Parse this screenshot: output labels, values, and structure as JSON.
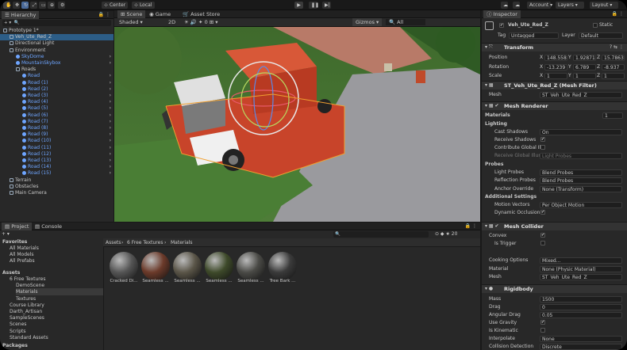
{
  "toolbar": {
    "pivot": "Center",
    "space": "Local",
    "account": "Account",
    "layers": "Layers",
    "layout": "Layout"
  },
  "hierarchy": {
    "tab": "Hierarchy",
    "items": [
      {
        "label": "Prototype 1*",
        "indent": 0,
        "kind": "scene"
      },
      {
        "label": "Veh_Ute_Red_Z",
        "indent": 1,
        "kind": "obj"
      },
      {
        "label": "Directional Light",
        "indent": 1,
        "kind": "obj"
      },
      {
        "label": "Environment",
        "indent": 1,
        "kind": "obj"
      },
      {
        "label": "SkyDome",
        "indent": 2,
        "kind": "prefab"
      },
      {
        "label": "MountainSkybox",
        "indent": 2,
        "kind": "prefab"
      },
      {
        "label": "Roads",
        "indent": 2,
        "kind": "obj"
      },
      {
        "label": "Road",
        "indent": 3,
        "kind": "prefab"
      },
      {
        "label": "Road (1)",
        "indent": 3,
        "kind": "prefab"
      },
      {
        "label": "Road (2)",
        "indent": 3,
        "kind": "prefab"
      },
      {
        "label": "Road (3)",
        "indent": 3,
        "kind": "prefab"
      },
      {
        "label": "Road (4)",
        "indent": 3,
        "kind": "prefab"
      },
      {
        "label": "Road (5)",
        "indent": 3,
        "kind": "prefab"
      },
      {
        "label": "Road (6)",
        "indent": 3,
        "kind": "prefab"
      },
      {
        "label": "Road (7)",
        "indent": 3,
        "kind": "prefab"
      },
      {
        "label": "Road (8)",
        "indent": 3,
        "kind": "prefab"
      },
      {
        "label": "Road (9)",
        "indent": 3,
        "kind": "prefab"
      },
      {
        "label": "Road (10)",
        "indent": 3,
        "kind": "prefab"
      },
      {
        "label": "Road (11)",
        "indent": 3,
        "kind": "prefab"
      },
      {
        "label": "Road (12)",
        "indent": 3,
        "kind": "prefab"
      },
      {
        "label": "Road (13)",
        "indent": 3,
        "kind": "prefab"
      },
      {
        "label": "Road (14)",
        "indent": 3,
        "kind": "prefab"
      },
      {
        "label": "Road (15)",
        "indent": 3,
        "kind": "prefab"
      },
      {
        "label": "Terrain",
        "indent": 1,
        "kind": "obj"
      },
      {
        "label": "Obstacles",
        "indent": 1,
        "kind": "obj"
      },
      {
        "label": "Main Camera",
        "indent": 1,
        "kind": "obj"
      }
    ]
  },
  "scene": {
    "tabs": [
      "Scene",
      "Game",
      "Asset Store"
    ],
    "shading": "Shaded",
    "mode2d": "2D",
    "gizmos": "Gizmos",
    "gizmo_count": "0"
  },
  "inspector": {
    "tab": "Inspector",
    "name": "Veh_Ute_Red_Z",
    "static": "Static",
    "tag_label": "Tag",
    "tag": "Untagged",
    "layer_label": "Layer",
    "layer": "Default",
    "transform": {
      "title": "Transform",
      "position_label": "Position",
      "rotation_label": "Rotation",
      "scale_label": "Scale",
      "position": {
        "x": "148.558",
        "y": "1.92871",
        "z": "15.7863"
      },
      "rotation": {
        "x": "-13.239",
        "y": "6.789",
        "z": "-8.937"
      },
      "scale": {
        "x": "1",
        "y": "1",
        "z": "1"
      }
    },
    "meshfilter": {
      "title": "ST_Veh_Ute_Red_Z (Mesh Filter)",
      "mesh_label": "Mesh",
      "mesh": "ST_Veh_Ute_Red_Z"
    },
    "renderer": {
      "title": "Mesh Renderer",
      "materials": "Materials",
      "materials_count": "1",
      "lighting": "Lighting",
      "cast_label": "Cast Shadows",
      "cast": "On",
      "receive_label": "Receive Shadows",
      "contribute_label": "Contribute Global Il",
      "receive_gi_label": "Receive Global Illum",
      "receive_gi": "Light Probes",
      "probes": "Probes",
      "lightprobes_label": "Light Probes",
      "lightprobes": "Blend Probes",
      "reflection_label": "Reflection Probes",
      "reflection": "Blend Probes",
      "anchor_label": "Anchor Override",
      "anchor": "None (Transform)",
      "additional": "Additional Settings",
      "motion_label": "Motion Vectors",
      "motion": "Per Object Motion",
      "occlusion_label": "Dynamic Occlusion"
    },
    "collider": {
      "title": "Mesh Collider",
      "convex_label": "Convex",
      "trigger_label": "Is Trigger",
      "cooking_label": "Cooking Options",
      "cooking": "Mixed...",
      "material_label": "Material",
      "material": "None (Physic Material)",
      "mesh_label": "Mesh",
      "mesh": "ST_Veh_Ute_Red_Z"
    },
    "rigidbody": {
      "title": "Rigidbody",
      "mass_label": "Mass",
      "mass": "1500",
      "drag_label": "Drag",
      "drag": "0",
      "angular_label": "Angular Drag",
      "angular": "0.05",
      "gravity_label": "Use Gravity",
      "kinematic_label": "Is Kinematic",
      "interpolate_label": "Interpolate",
      "interpolate": "None",
      "collision_label": "Collision Detection",
      "collision": "Discrete"
    }
  },
  "project": {
    "tabs": [
      "Project",
      "Console"
    ],
    "breadcrumb": [
      "Assets",
      "6 Free Textures",
      "Materials"
    ],
    "favorites": "Favorites",
    "fav_items": [
      "All Materials",
      "All Models",
      "All Prefabs"
    ],
    "assets": "Assets",
    "tree": [
      {
        "label": "6 Free Textures",
        "indent": 1
      },
      {
        "label": "DemoScene",
        "indent": 2
      },
      {
        "label": "Materials",
        "indent": 2
      },
      {
        "label": "Textures",
        "indent": 2
      },
      {
        "label": "Course Library",
        "indent": 1
      },
      {
        "label": "Darth_Artisan",
        "indent": 1
      },
      {
        "label": "SampleScenes",
        "indent": 1
      },
      {
        "label": "Scenes",
        "indent": 1
      },
      {
        "label": "Scripts",
        "indent": 1
      },
      {
        "label": "Standard Assets",
        "indent": 1
      }
    ],
    "packages": "Packages",
    "materials": [
      {
        "label": "Cracked Di...",
        "color": "#555"
      },
      {
        "label": "Seamless ...",
        "color": "#6b3a2a"
      },
      {
        "label": "Seamless ...",
        "color": "#5a5548"
      },
      {
        "label": "Seamless ...",
        "color": "#3e4a2a"
      },
      {
        "label": "Seamless ...",
        "color": "#4a4a46"
      },
      {
        "label": "Tree Bark ...",
        "color": "#3a3a3a"
      }
    ],
    "count": "20"
  }
}
